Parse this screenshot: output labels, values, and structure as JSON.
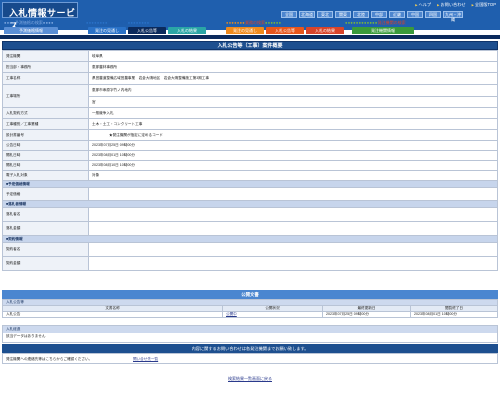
{
  "header": {
    "logo": "入札情報サービス",
    "top_links": [
      "ヘルプ",
      "お問い合わせ",
      "全国版TOP"
    ],
    "regions": [
      "全国",
      "北海道",
      "東北",
      "関東",
      "北陸",
      "中部",
      "近畿",
      "中国",
      "四国",
      "九州・沖縄"
    ]
  },
  "categories": {
    "left": "予測価格の検索",
    "construction": "工事の検索",
    "service": "業務の検索",
    "orderer": "発注機関の検索"
  },
  "tabs": {
    "left": "予測価格情報",
    "construction": [
      "発注の見通し",
      "入札公告等",
      "入札の結果"
    ],
    "service": [
      "発注の見通し",
      "入札公告等",
      "入札の結果"
    ],
    "orderer": "発注機関情報"
  },
  "main": {
    "title": "入札公告等（工事）案件概要",
    "rows": [
      {
        "label": "発注機関",
        "value": "岐阜県"
      },
      {
        "label": "担当部・事務所",
        "value": "恵那農林事務所"
      },
      {
        "label": "工事名称",
        "value": "県営農道整備広域営農事業　岩倉大鳴地区　岩倉大鳴整備施工第3期工事"
      },
      {
        "label": "工事場所",
        "values": [
          "恵那市串原字竹ノ内地内",
          "宮"
        ]
      },
      {
        "label": "入札契約方式",
        "value": "一般競争入札"
      },
      {
        "label": "工事種別／工事業種",
        "value": "土木・土工・コンクリート工事"
      },
      {
        "label": "設計書番号",
        "value": "★発注機関が指定に定めるコード"
      },
      {
        "label": "公告日時",
        "value": "2023年07月25日 09時00分"
      },
      {
        "label": "開札日時",
        "value": "2023年08月01日 10時00分"
      },
      {
        "label": "開札日時",
        "value": "2023年08月10日 10時00分"
      },
      {
        "label": "電子入札対象",
        "value": "対象"
      }
    ],
    "sections": {
      "price": {
        "title": "■予定価格情報",
        "rows": [
          "予定価格"
        ]
      },
      "bidder": {
        "title": "■落札者情報",
        "rows": [
          "落札者名",
          "落札金額"
        ]
      },
      "contract": {
        "title": "■契約情報",
        "rows": [
          "契約者名",
          "契約金額"
        ]
      }
    }
  },
  "docs": {
    "title": "公開文書",
    "band": "入札公告等",
    "columns": [
      "文書名称",
      "公開状況",
      "最終更新日",
      "閲覧終了日"
    ],
    "row": {
      "name": "入札公告",
      "status": "公開中",
      "updated": "2023年07月25日 09時00分",
      "end": "2023年08月01日 10時00分"
    }
  },
  "entry": {
    "head": "入札経過",
    "body": "該当データはありません"
  },
  "contact": {
    "title": "内容に関するお問い合わせは各発注機関までお願い致します。",
    "text": "発注機関への連絡先等はこちらからご確認ください。",
    "link": "問い合せ先一覧"
  },
  "back": "検索結果一覧画面に戻る",
  "colors": {
    "header_blue": "#1f5fae",
    "navy": "#0b2a5c",
    "section_blue": "#c7d5ec",
    "tab_orange": "#f08a1c",
    "tab_teal": "#2aa6a6",
    "tab_green": "#3a9a3a",
    "tab_lightblue": "#3a86d6"
  }
}
